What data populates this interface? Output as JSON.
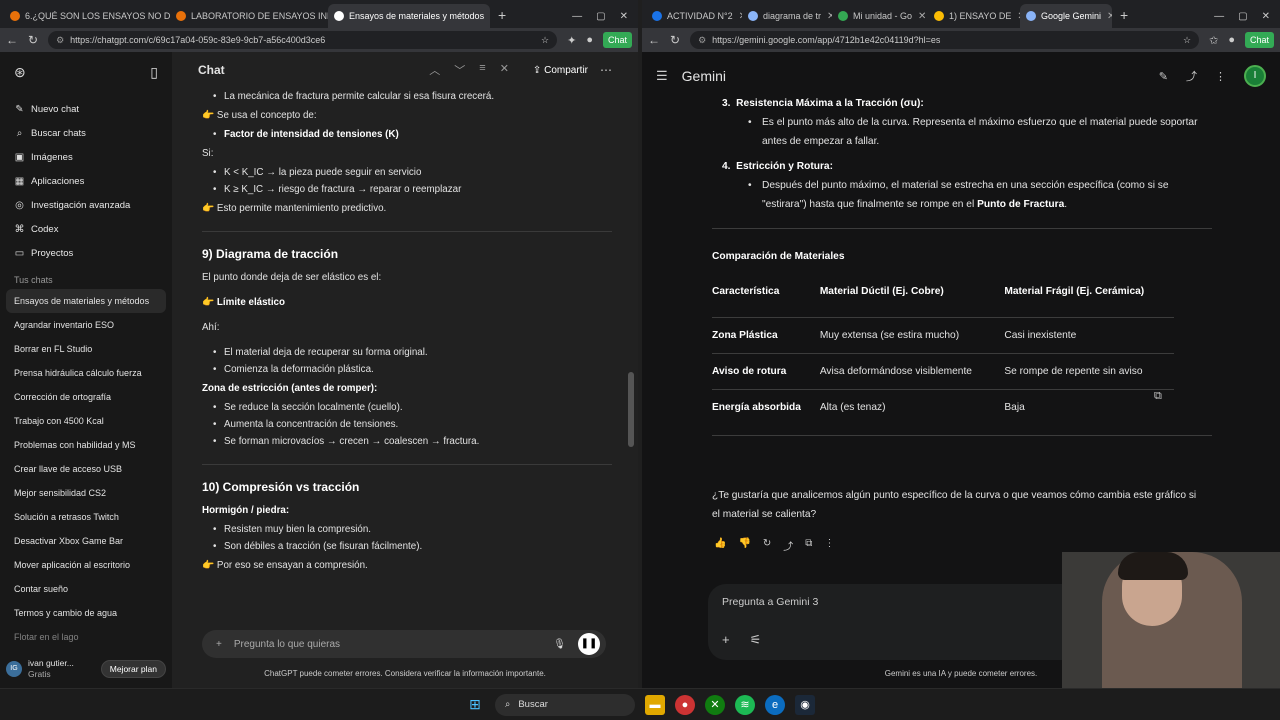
{
  "left_browser": {
    "tabs": [
      {
        "label": "6.¿QUÉ SON LOS ENSAYOS NO D",
        "color": "#e8710a"
      },
      {
        "label": "LABORATORIO DE ENSAYOS INDU",
        "color": "#e8710a"
      },
      {
        "label": "Ensayos de materiales y métodos",
        "color": "#ffffff",
        "active": true
      }
    ],
    "url": "https://chatgpt.com/c/69c17a04-059c-83e9-9cb7-a56c400d3ce6",
    "chip": "Chat"
  },
  "chatgpt": {
    "sidebar": {
      "nav": [
        {
          "label": "Nuevo chat",
          "icon": "edit-icon",
          "glyph": "✎"
        },
        {
          "label": "Buscar chats",
          "icon": "search-icon",
          "glyph": "⌕"
        },
        {
          "label": "Imágenes",
          "icon": "image-icon",
          "glyph": "▣"
        },
        {
          "label": "Aplicaciones",
          "icon": "apps-icon",
          "glyph": "▦"
        },
        {
          "label": "Investigación avanzada",
          "icon": "research-icon",
          "glyph": "◎"
        },
        {
          "label": "Codex",
          "icon": "codex-icon",
          "glyph": "⌘"
        },
        {
          "label": "Proyectos",
          "icon": "folder-icon",
          "glyph": "▭"
        }
      ],
      "section": "Tus chats",
      "chats": [
        "Ensayos de materiales y métodos",
        "Agrandar inventario ESO",
        "Borrar en FL Studio",
        "Prensa hidráulica cálculo fuerza",
        "Corrección de ortografía",
        "Trabajo con 4500 Kcal",
        "Problemas con habilidad y MS",
        "Crear llave de acceso USB",
        "Mejor sensibilidad CS2",
        "Solución a retrasos Twitch",
        "Desactivar Xbox Game Bar",
        "Mover aplicación al escritorio",
        "Contar sueño",
        "Termos y cambio de agua",
        "Flotar en el lago"
      ],
      "user": {
        "initials": "IG",
        "name": "ivan gutier...",
        "plan": "Gratis",
        "upgrade": "Mejorar plan"
      }
    },
    "header": {
      "title": "Chat",
      "share": "Compartir"
    },
    "content": {
      "b1": "La mecánica de fractura permite calcular si esa fisura crecerá.",
      "p1": "👉 Se usa el concepto de:",
      "b2": "Factor de intensidad de tensiones (K)",
      "si": "Si:",
      "b3": "K < K_IC → la pieza puede seguir en servicio",
      "b4": "K ≥ K_IC → riesgo de fractura → reparar o reemplazar",
      "p2": "👉 Esto permite mantenimiento predictivo.",
      "h9": "9) Diagrama de tracción",
      "p3": "El punto donde deja de ser elástico es el:",
      "p4": "👉 Límite elástico",
      "ahi": "Ahí:",
      "b5": "El material deja de recuperar su forma original.",
      "b6": "Comienza la deformación plástica.",
      "zona": "Zona de estricción (antes de romper):",
      "b7": "Se reduce la sección localmente (cuello).",
      "b8": "Aumenta la concentración de tensiones.",
      "b9": "Se forman microvacíos → crecen → coalescen → fractura.",
      "h10": "10) Compresión vs tracción",
      "horm": "Hormigón / piedra:",
      "b10": "Resisten muy bien la compresión.",
      "b11": "Son débiles a tracción (se fisuran fácilmente).",
      "p5": "👉 Por eso se ensayan a compresión."
    },
    "composer_placeholder": "Pregunta lo que quieras",
    "disclaimer": "ChatGPT puede cometer errores. Considera verificar la información importante."
  },
  "right_browser": {
    "tabs": [
      {
        "label": "ACTIVIDAD N°2",
        "color": "#1a73e8"
      },
      {
        "label": "diagrama de tr",
        "color": "#8ab4f8"
      },
      {
        "label": "Mi unidad - Go",
        "color": "#34a853"
      },
      {
        "label": "1) ENSAYO DE",
        "color": "#fbbc04"
      },
      {
        "label": "Google Gemini",
        "color": "#8ab4f8",
        "active": true
      }
    ],
    "url": "https://gemini.google.com/app/4712b1e42c04119d?hl=es",
    "chip": "Chat"
  },
  "gemini": {
    "title": "Gemini",
    "avatar": "I",
    "item3_title": "Resistencia Máxima a la Tracción (σu):",
    "item3_text": "Es el punto más alto de la curva. Representa el máximo esfuerzo que el material puede soportar antes de empezar a fallar.",
    "item4_title": "Estricción y Rotura:",
    "item4_text": "Después del punto máximo, el material se estrecha en una sección específica (como si se \"estirara\") hasta que finalmente se rompe en el",
    "item4_bold": "Punto de Fractura",
    "subtitle": "Comparación de Materiales",
    "table": {
      "headers": [
        "Característica",
        "Material Dúctil (Ej. Cobre)",
        "Material Frágil (Ej. Cerámica)"
      ],
      "rows": [
        [
          "Zona Plástica",
          "Muy extensa (se estira mucho)",
          "Casi inexistente"
        ],
        [
          "Aviso de rotura",
          "Avisa deformándose visiblemente",
          "Se rompe de repente sin aviso"
        ],
        [
          "Energía absorbida",
          "Alta (es tenaz)",
          "Baja"
        ]
      ]
    },
    "question": "¿Te gustaría que analicemos algún punto específico de la curva o que veamos cómo cambia este gráfico si el material se calienta?",
    "composer_placeholder": "Pregunta a Gemini 3",
    "disclaimer": "Gemini es una IA y puede cometer errores."
  },
  "taskbar": {
    "search": "Buscar"
  }
}
